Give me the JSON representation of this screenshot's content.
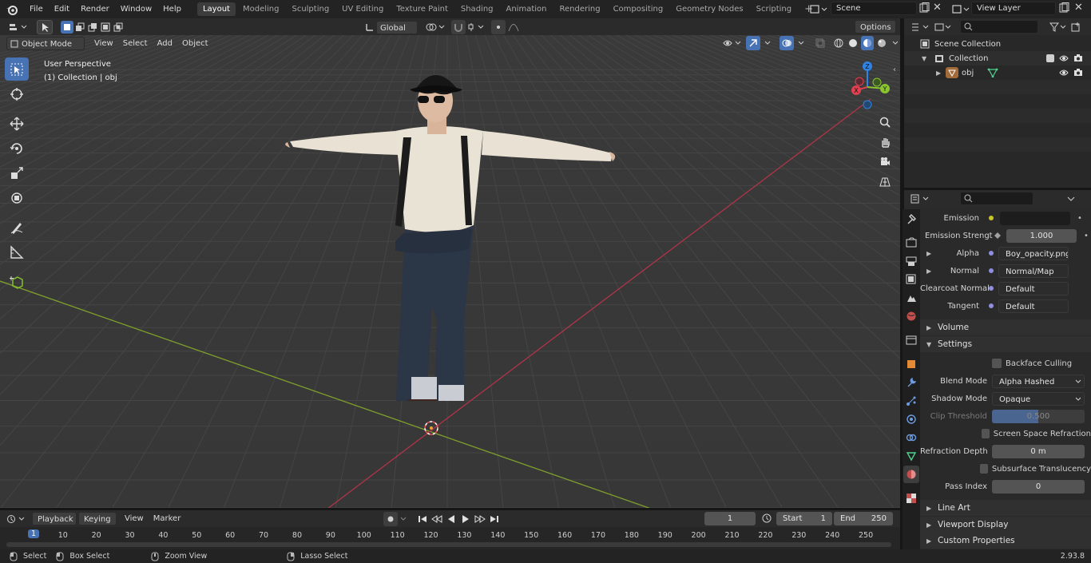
{
  "menubar": {
    "items": [
      "File",
      "Edit",
      "Render",
      "Window",
      "Help"
    ]
  },
  "workspaces": [
    "Layout",
    "Modeling",
    "Sculpting",
    "UV Editing",
    "Texture Paint",
    "Shading",
    "Animation",
    "Rendering",
    "Compositing",
    "Geometry Nodes",
    "Scripting"
  ],
  "scene": {
    "name": "Scene",
    "view_layer": "View Layer"
  },
  "viewport_header": {
    "mode": "Object Mode",
    "menus": [
      "View",
      "Select",
      "Add",
      "Object"
    ],
    "transform_orientation": "Global",
    "options": "Options"
  },
  "viewport": {
    "perspective_label": "User Perspective",
    "collection_label": "(1) Collection | obj",
    "gizmo": {
      "x": "X",
      "y": "Y",
      "z": "Z"
    }
  },
  "outliner": {
    "scene_collection": "Scene Collection",
    "collection": "Collection",
    "object": "obj"
  },
  "properties": {
    "rows": {
      "emission": {
        "label": "Emission"
      },
      "emission_strength": {
        "label": "Emission Strengt",
        "value": "1.000"
      },
      "alpha": {
        "label": "Alpha",
        "value": "Boy_opacity.png"
      },
      "normal": {
        "label": "Normal",
        "value": "Normal/Map"
      },
      "clearcoat_normal": {
        "label": "Clearcoat Normal",
        "value": "Default"
      },
      "tangent": {
        "label": "Tangent",
        "value": "Default"
      }
    },
    "sections": {
      "volume": "Volume",
      "settings": "Settings",
      "line_art": "Line Art",
      "viewport_display": "Viewport Display",
      "custom_properties": "Custom Properties"
    },
    "settings": {
      "backface_culling": "Backface Culling",
      "blend_mode_label": "Blend Mode",
      "blend_mode": "Alpha Hashed",
      "shadow_mode_label": "Shadow Mode",
      "shadow_mode": "Opaque",
      "clip_threshold_label": "Clip Threshold",
      "clip_threshold": "0.500",
      "screen_space_refraction": "Screen Space Refraction",
      "refraction_depth_label": "Refraction Depth",
      "refraction_depth": "0 m",
      "subsurface_translucency": "Subsurface Translucency",
      "pass_index_label": "Pass Index",
      "pass_index": "0"
    }
  },
  "timeline": {
    "menus": [
      "Playback",
      "Keying",
      "View",
      "Marker"
    ],
    "current_frame": "1",
    "start_label": "Start",
    "start": "1",
    "end_label": "End",
    "end": "250",
    "ticks": [
      "1",
      "10",
      "20",
      "30",
      "40",
      "50",
      "60",
      "70",
      "80",
      "90",
      "100",
      "110",
      "120",
      "130",
      "140",
      "150",
      "160",
      "170",
      "180",
      "190",
      "200",
      "210",
      "220",
      "230",
      "240",
      "250"
    ]
  },
  "statusbar": {
    "select": "Select",
    "box_select": "Box Select",
    "zoom_view": "Zoom View",
    "lasso_select": "Lasso Select",
    "version": "2.93.8"
  },
  "colors": {
    "accent": "#4772b3",
    "x_axis": "#e0404f",
    "y_axis": "#8ac531",
    "z_axis": "#2f83e6"
  }
}
